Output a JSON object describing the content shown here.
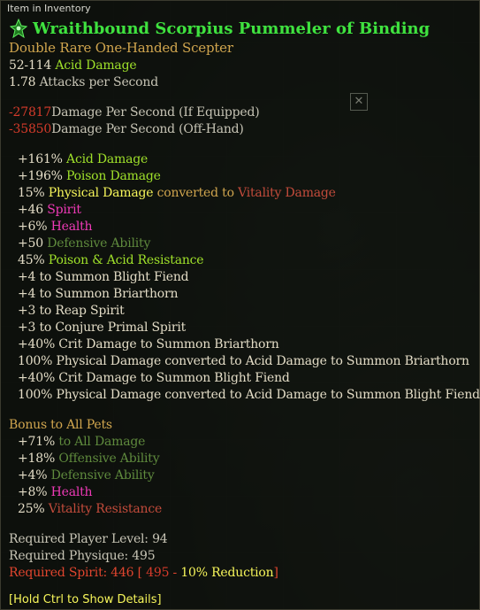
{
  "header": "Item in Inventory",
  "item_name": "Wraithbound Scorpius Pummeler of Binding",
  "item_type": "Double Rare One-Handed Scepter",
  "base": {
    "damage_range": "52-114",
    "damage_type": "Acid Damage",
    "aps_value": "1.78",
    "aps_label": "Attacks per Second"
  },
  "dps": [
    {
      "value": "-27817",
      "label": "Damage Per Second (If Equipped)"
    },
    {
      "value": "-35850",
      "label": "Damage Per Second (Off-Hand)"
    }
  ],
  "stats": {
    "acid": {
      "value": "+161%",
      "label": "Acid Damage"
    },
    "poison": {
      "value": "+196%",
      "label": "Poison Damage"
    },
    "conv": {
      "pct": "15%",
      "from": "Physical Damage",
      "mid": "converted to",
      "to": "Vitality Damage"
    },
    "spirit": {
      "value": "+46",
      "label": "Spirit"
    },
    "health": {
      "value": "+6%",
      "label": "Health"
    },
    "da": {
      "value": "+50",
      "label": "Defensive Ability"
    },
    "res": {
      "value": "45%",
      "label": "Poison & Acid Resistance"
    },
    "skills": [
      "+4 to Summon Blight Fiend",
      "+4 to Summon Briarthorn",
      "+3 to Reap Spirit",
      "+3 to Conjure Primal Spirit",
      "+40% Crit Damage to Summon Briarthorn",
      "100% Physical Damage converted to Acid Damage to Summon Briarthorn",
      "+40% Crit Damage to Summon Blight Fiend",
      "100% Physical Damage converted to Acid Damage to Summon Blight Fiend"
    ]
  },
  "pets": {
    "heading": "Bonus to All Pets",
    "all_damage": {
      "value": "+71%",
      "label": "to All Damage"
    },
    "oa": {
      "value": "+18%",
      "label": "Offensive Ability"
    },
    "da": {
      "value": "+4%",
      "label": "Defensive Ability"
    },
    "health": {
      "value": "+8%",
      "label": "Health"
    },
    "vit_res": {
      "value": "25%",
      "label": "Vitality Resistance"
    }
  },
  "requirements": {
    "level": "Required Player Level: 94",
    "physique": "Required Physique: 495",
    "spirit_prefix": "Required Spirit: 446 [ ",
    "spirit_base": "495",
    "spirit_sep": " - ",
    "spirit_reduction": "10% Reduction",
    "spirit_close": "]"
  },
  "footer": "[Hold Ctrl to Show Details]",
  "colors": {
    "title": "#3fe23f",
    "magic_text": "#f6f55a",
    "damage_green": "#9fe02a",
    "negative_dps": "#d53b2b",
    "pink_attr": "#f03ab8"
  }
}
